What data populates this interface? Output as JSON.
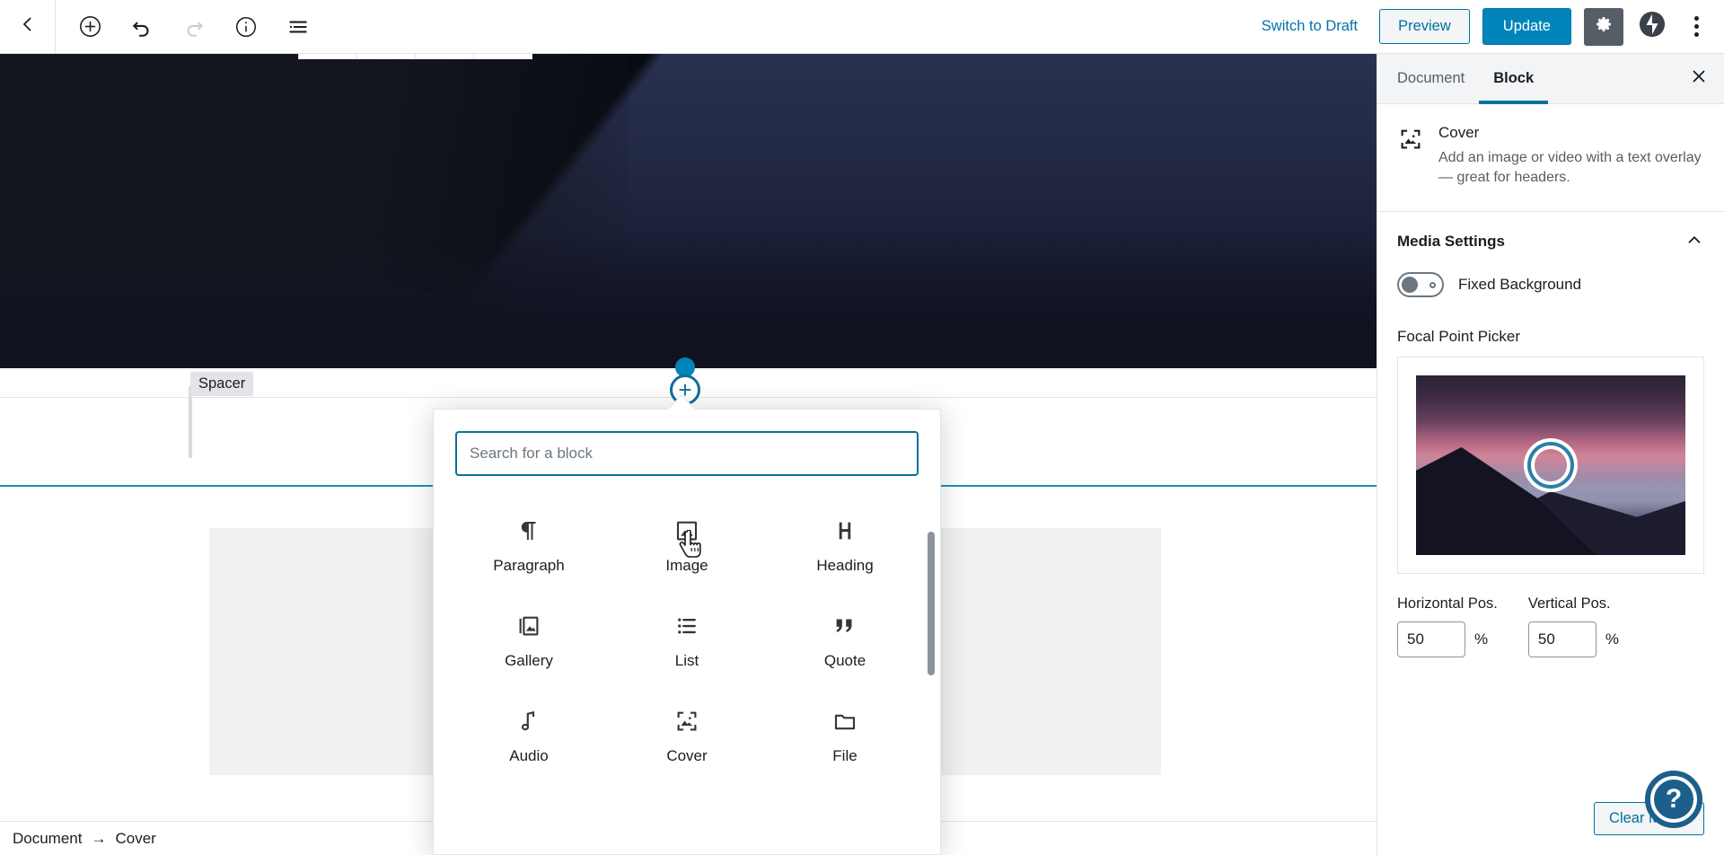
{
  "topbar": {
    "back_icon": "chevron-left-icon",
    "tools": [
      {
        "name": "add-block-button",
        "icon": "plus-circle-icon",
        "disabled": false
      },
      {
        "name": "undo-button",
        "icon": "undo-icon",
        "disabled": false
      },
      {
        "name": "redo-button",
        "icon": "redo-icon",
        "disabled": true
      },
      {
        "name": "content-info-button",
        "icon": "info-circle-icon",
        "disabled": false
      },
      {
        "name": "block-navigation-button",
        "icon": "list-view-icon",
        "disabled": false
      }
    ],
    "switch_to_draft": "Switch to Draft",
    "preview": "Preview",
    "update": "Update",
    "settings_icon": "gear-icon",
    "jetpack_icon": "jetpack-icon",
    "more_icon": "kebab-menu-icon",
    "accent_blue": "#0085ba",
    "link_blue": "#0073aa"
  },
  "block_toolbar": {
    "cover_icon": "cover-block-icon",
    "align_icon": "full-width-align-icon",
    "edit_icon": "pencil-icon",
    "more_icon": "kebab-menu-icon"
  },
  "canvas": {
    "spacer_label": "Spacer",
    "inserter_plus": "+"
  },
  "inserter": {
    "search_placeholder": "Search for a block",
    "search_value": "",
    "blocks": [
      {
        "label": "Paragraph",
        "icon": "paragraph-icon"
      },
      {
        "label": "Image",
        "icon": "image-icon"
      },
      {
        "label": "Heading",
        "icon": "heading-icon"
      },
      {
        "label": "Gallery",
        "icon": "gallery-icon"
      },
      {
        "label": "List",
        "icon": "list-icon"
      },
      {
        "label": "Quote",
        "icon": "quote-icon"
      },
      {
        "label": "Audio",
        "icon": "audio-note-icon"
      },
      {
        "label": "Cover",
        "icon": "cover-block-icon"
      },
      {
        "label": "File",
        "icon": "file-folder-icon"
      }
    ]
  },
  "sidebar": {
    "tabs": [
      {
        "label": "Document",
        "active": false
      },
      {
        "label": "Block",
        "active": true
      }
    ],
    "close_icon": "close-icon",
    "block_card": {
      "icon": "cover-block-icon",
      "title": "Cover",
      "description": "Add an image or video with a text overlay — great for headers."
    },
    "media_settings": {
      "title": "Media Settings",
      "collapse_icon": "chevron-up-icon",
      "fixed_background_label": "Fixed Background",
      "fixed_background_on": false,
      "focal_point_label": "Focal Point Picker",
      "horizontal_label": "Horizontal Pos.",
      "horizontal_value": "50",
      "vertical_label": "Vertical Pos.",
      "vertical_value": "50",
      "unit": "%"
    },
    "clear_media": "Clear Media",
    "active_tab_underline": "#00739c"
  },
  "help": {
    "icon": "question-mark-icon",
    "label": "?"
  },
  "breadcrumb": {
    "items": [
      "Document",
      "Cover"
    ],
    "separator": "→"
  }
}
